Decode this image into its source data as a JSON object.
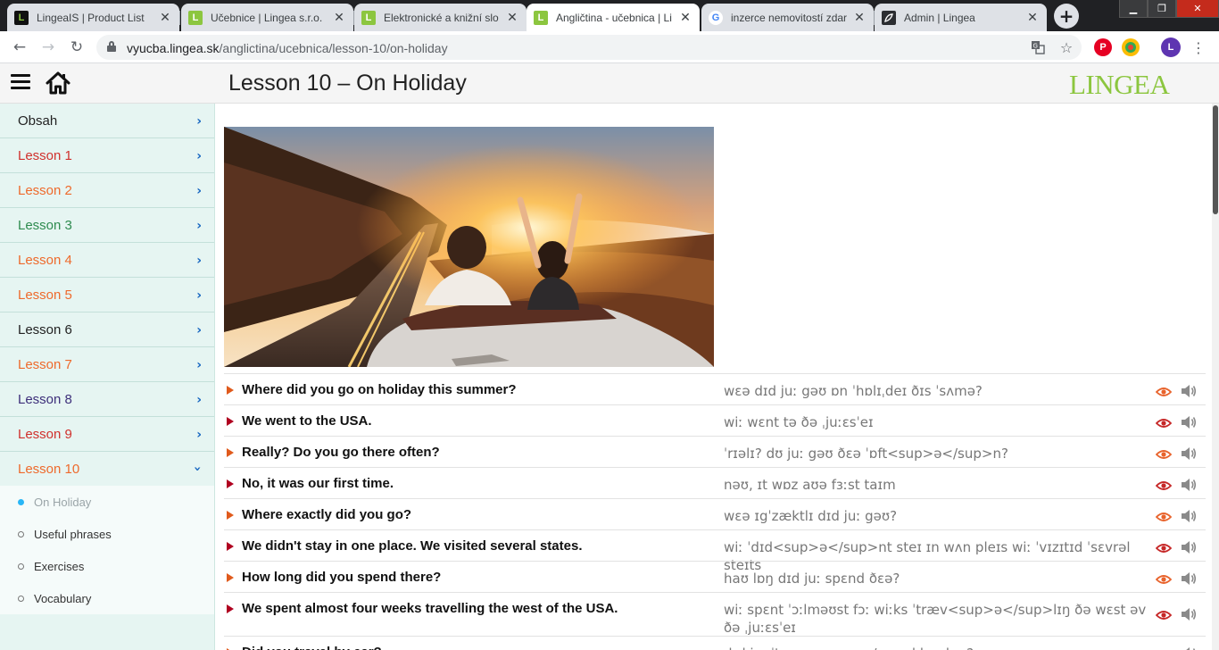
{
  "browser": {
    "tabs": [
      {
        "title": "LingeaIS | Product List",
        "favicon": "L"
      },
      {
        "title": "Učebnice | Lingea s.r.o.",
        "favicon": "L"
      },
      {
        "title": "Elektronické a knižní slo",
        "favicon": "L"
      },
      {
        "title": "Angličtina - učebnica | Li",
        "favicon": "L"
      },
      {
        "title": "inzerce nemovitostí zdar",
        "favicon": "G"
      },
      {
        "title": "Admin | Lingea",
        "favicon": "admin-logo-icon"
      }
    ],
    "active_tab": 3,
    "url_domain": "vyucba.lingea.sk",
    "url_path": "/anglictina/ucebnica/lesson-10/on-holiday",
    "profile_initial": "L"
  },
  "header": {
    "title": "Lesson 10 – On Holiday",
    "logo": "LINGEA"
  },
  "sidebar": {
    "items": [
      {
        "label": "Obsah",
        "color": "#222222"
      },
      {
        "label": "Lesson 1",
        "color": "#d0312d"
      },
      {
        "label": "Lesson 2",
        "color": "#ee6a2c"
      },
      {
        "label": "Lesson 3",
        "color": "#2e8b4f"
      },
      {
        "label": "Lesson 4",
        "color": "#ee6a2c"
      },
      {
        "label": "Lesson 5",
        "color": "#ee6a2c"
      },
      {
        "label": "Lesson 6",
        "color": "#222222"
      },
      {
        "label": "Lesson 7",
        "color": "#ee6a2c"
      },
      {
        "label": "Lesson 8",
        "color": "#3d2f7a"
      },
      {
        "label": "Lesson 9",
        "color": "#d0312d"
      },
      {
        "label": "Lesson 10",
        "color": "#ee6a2c"
      }
    ],
    "subitems": [
      {
        "label": "On Holiday",
        "active": true
      },
      {
        "label": "Useful phrases",
        "active": false
      },
      {
        "label": "Exercises",
        "active": false
      },
      {
        "label": "Vocabulary",
        "active": false
      }
    ]
  },
  "phrases": [
    {
      "en": "Where did you go on holiday this summer?",
      "ipa": "wɛə dɪd juː gəʊ ɒn ˈhɒlɪˌdeɪ ðɪs ˈsʌmə?",
      "marker": "orange"
    },
    {
      "en": "We went to the USA.",
      "ipa": "wiː wɛnt tə ðə ˌjuːɛsˈeɪ",
      "marker": "red"
    },
    {
      "en": "Really? Do you go there often?",
      "ipa": "ˈrɪəlɪ? dʊ juː gəʊ ðɛə ˈɒft<sup>ə</sup>n?",
      "marker": "orange"
    },
    {
      "en": "No, it was our first time.",
      "ipa": "nəʊ, ɪt wɒz aʊə fɜːst taɪm",
      "marker": "red"
    },
    {
      "en": "Where exactly did you go?",
      "ipa": "wɛə ɪgˈzæktlɪ dɪd juː gəʊ?",
      "marker": "orange"
    },
    {
      "en": "We didn't stay in one place. We visited several states.",
      "ipa": "wiː ˈdɪd<sup>ə</sup>nt steɪ ɪn wʌn pleɪs wiː ˈvɪzɪtɪd ˈsɛvrəl steɪts",
      "marker": "red"
    },
    {
      "en": "How long did you spend there?",
      "ipa": "haʊ lɒŋ dɪd juː spɛnd ðɛə?",
      "marker": "orange"
    },
    {
      "en": "We spent almost four weeks travelling the west of the USA.",
      "ipa": "wiː spɛnt ˈɔːlməʊst fɔː wiːks ˈtræv<sup>ə</sup>lɪŋ ðə wɛst əv ðə ˌjuːɛsˈeɪ",
      "marker": "red"
    },
    {
      "en": "Did you travel by car?",
      "ipa": "dɪd juː ˈtræv<sup>ə</sup>l baɪ kɑː?",
      "marker": "orange"
    }
  ]
}
